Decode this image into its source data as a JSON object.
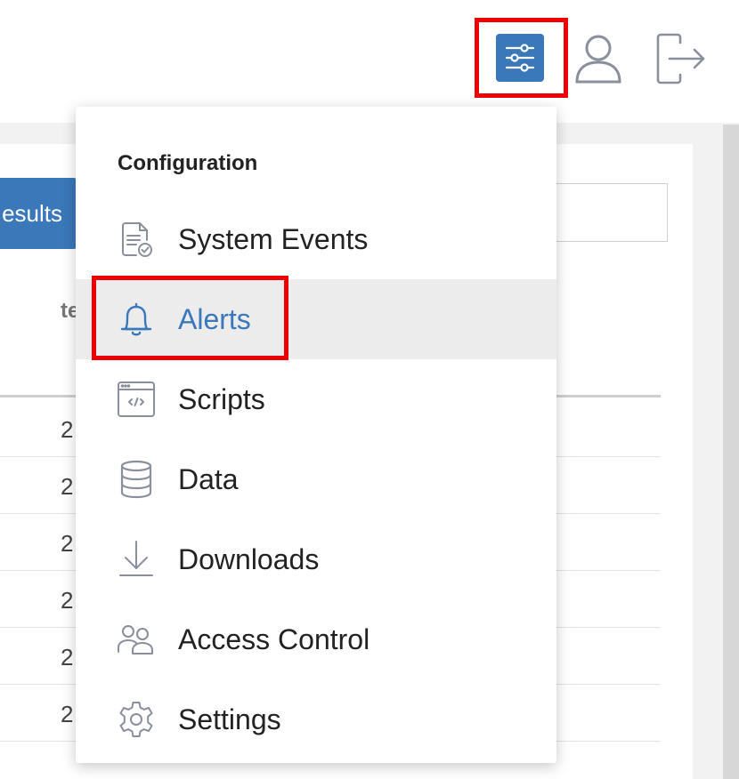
{
  "header": {
    "config_icon": "sliders-icon",
    "user_icon": "user-icon",
    "logout_icon": "logout-icon"
  },
  "background": {
    "results_button_label": "esults",
    "column_header_partial": "te",
    "row_cell_partials": [
      "2",
      "2",
      "2",
      "2",
      "2",
      "2"
    ]
  },
  "menu": {
    "heading": "Configuration",
    "items": [
      {
        "label": "System Events",
        "icon": "document-check-icon"
      },
      {
        "label": "Alerts",
        "icon": "bell-icon",
        "active": true
      },
      {
        "label": "Scripts",
        "icon": "code-window-icon"
      },
      {
        "label": "Data",
        "icon": "database-icon"
      },
      {
        "label": "Downloads",
        "icon": "download-icon"
      },
      {
        "label": "Access Control",
        "icon": "users-icon"
      },
      {
        "label": "Settings",
        "icon": "gear-icon"
      }
    ]
  },
  "colors": {
    "accent": "#3a78b9",
    "highlight": "#ee0000",
    "active_row": "#ececec"
  }
}
